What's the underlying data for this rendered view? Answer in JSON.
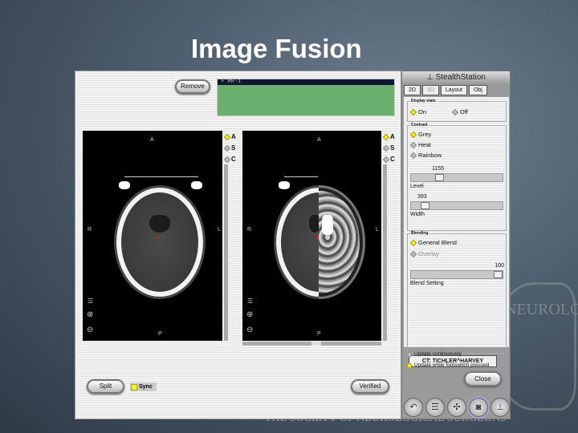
{
  "slide": {
    "title": "Image Fusion",
    "footer": "THE SOCIETY OF NEUROLOGICAL SURGEONS",
    "seal_text": "NEUROLO"
  },
  "main": {
    "remove_label": "Remove",
    "image_list": [
      "+ MR-1"
    ],
    "viewers": [
      {
        "labels": {
          "top": "A",
          "left": "R",
          "right": "L",
          "bottom": "P"
        },
        "orientations": [
          {
            "label": "A",
            "selected": true
          },
          {
            "label": "S",
            "selected": false
          },
          {
            "label": "C",
            "selected": false
          }
        ]
      },
      {
        "labels": {
          "top": "A",
          "left": "R",
          "right": "L",
          "bottom": "P"
        },
        "orientations": [
          {
            "label": "A",
            "selected": true
          },
          {
            "label": "S",
            "selected": false
          },
          {
            "label": "C",
            "selected": false
          }
        ]
      }
    ],
    "split_label": "Split",
    "sync_label": "Sync",
    "sync_checked": true,
    "verified_label": "Verified"
  },
  "panel": {
    "brand": "StealthStation",
    "tabs": [
      "2D",
      "3D",
      "Layout",
      "Obj"
    ],
    "display_state": {
      "label": "Display state",
      "options": [
        {
          "label": "On",
          "selected": true
        },
        {
          "label": "Off",
          "selected": false
        }
      ]
    },
    "contrast": {
      "label": "Contrast",
      "options": [
        {
          "label": "Grey",
          "selected": true
        },
        {
          "label": "Heat",
          "selected": false
        },
        {
          "label": "Rainbow",
          "selected": false
        }
      ],
      "level": {
        "label": "Level",
        "value": "1155"
      },
      "width": {
        "label": "Width",
        "value": "393"
      }
    },
    "blending": {
      "label": "Blending",
      "options": [
        {
          "label": "General Blend",
          "selected": true
        },
        {
          "label": "Overlay",
          "selected": false
        }
      ],
      "blend": {
        "label": "Blend Setting",
        "value": "100"
      }
    },
    "dataset_tab": "CT: TICHLER^HARVEY",
    "update": [
      {
        "label": "Update continuously",
        "selected": false
      },
      {
        "label": "Update while footswitch pressed",
        "selected": true
      }
    ],
    "close_label": "Close"
  },
  "colors": {
    "list_bg": "#6bb06f",
    "radio_on": "#eeee33"
  }
}
